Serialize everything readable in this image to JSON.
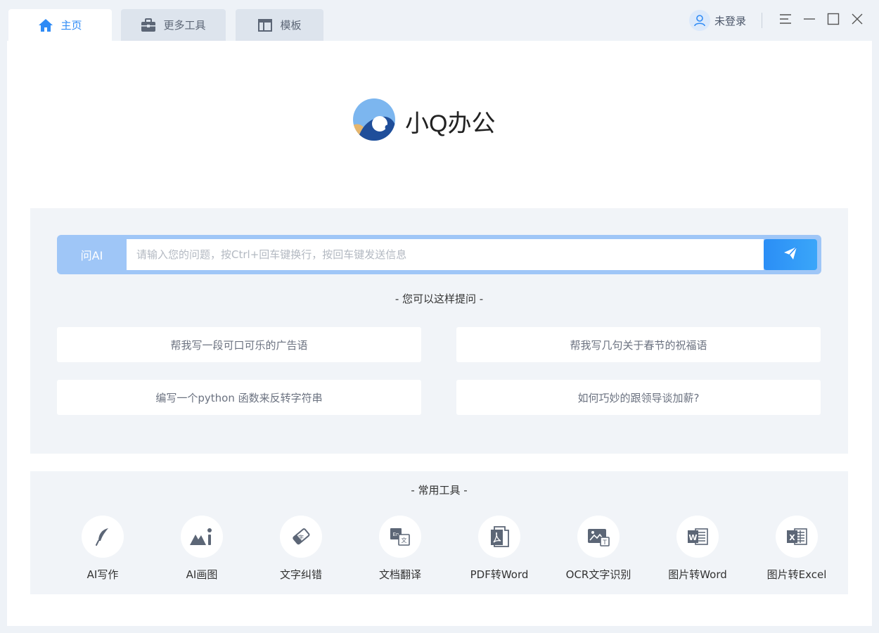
{
  "tabs": [
    {
      "label": "主页",
      "icon": "home-icon",
      "active": true
    },
    {
      "label": "更多工具",
      "icon": "briefcase-icon",
      "active": false
    },
    {
      "label": "模板",
      "icon": "template-icon",
      "active": false
    }
  ],
  "header": {
    "login_label": "未登录",
    "icons": [
      "user-icon",
      "menu-icon",
      "minimize-icon",
      "maximize-icon",
      "close-icon"
    ]
  },
  "brand": {
    "name": "小Q办公",
    "colors": {
      "primary": "#2f8bf5",
      "dark_blue": "#1f4e9a",
      "light_blue": "#7cb6ef",
      "gold": "#e5b56c"
    }
  },
  "ask": {
    "label": "问AI",
    "placeholder": "请输入您的问题，按Ctrl+回车键换行，按回车键发送信息",
    "value": "",
    "send_icon": "send-icon"
  },
  "suggestions": {
    "title": "- 您可以这样提问 -",
    "items": [
      "帮我写一段可口可乐的广告语",
      "帮我写几句关于春节的祝福语",
      "编写一个python 函数来反转字符串",
      "如何巧妙的跟领导谈加薪?"
    ]
  },
  "tools": {
    "title": "- 常用工具 -",
    "items": [
      {
        "label": "AI写作",
        "icon": "feather-pen-icon"
      },
      {
        "label": "AI画图",
        "icon": "ai-image-icon"
      },
      {
        "label": "文字纠错",
        "icon": "eraser-icon"
      },
      {
        "label": "文档翻译",
        "icon": "translate-icon"
      },
      {
        "label": "PDF转Word",
        "icon": "pdf-icon"
      },
      {
        "label": "OCR文字识别",
        "icon": "ocr-icon"
      },
      {
        "label": "图片转Word",
        "icon": "word-icon"
      },
      {
        "label": "图片转Excel",
        "icon": "excel-icon"
      }
    ]
  }
}
